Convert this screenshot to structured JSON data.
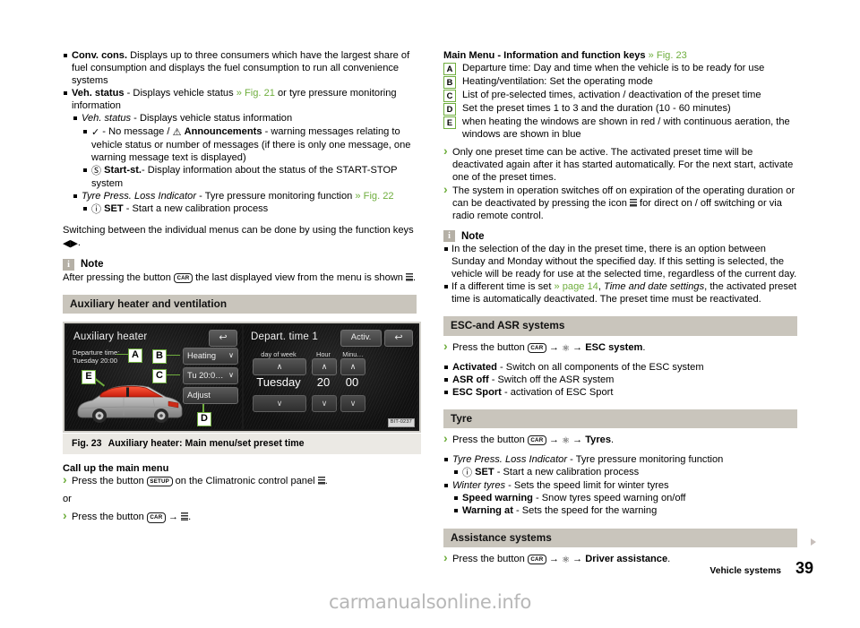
{
  "left_column": {
    "bullets": [
      {
        "level": 1,
        "term": "Conv. cons.",
        "text": " Displays up to three consumers which have the largest share of fuel consumption and displays the fuel consumption to run all convenience systems"
      },
      {
        "level": 1,
        "term": "Veh. status",
        "text": " - Displays vehicle status ",
        "ref": "» Fig. 21",
        "text_after": " or tyre pressure monitoring information"
      },
      {
        "level": 2,
        "term_italic": "Veh. status",
        "text": " - Displays vehicle status information"
      },
      {
        "level": 3,
        "prefix_glyph": "checkmark",
        "text_a": " - No message / ",
        "warn_glyph": "warning-triangle",
        "term": "Announcements",
        "text": " - warning messages relating to vehicle status or number of messages (if there is only one message, one warning message text is displayed)"
      },
      {
        "level": 3,
        "prefix_glyph": "start-stop",
        "term": "Start-st.",
        "text": "- Display information about the status of the START-STOP system"
      },
      {
        "level": 2,
        "term_italic": "Tyre Press. Loss Indicator",
        "text": " - Tyre pressure monitoring function ",
        "ref": "» Fig. 22"
      },
      {
        "level": 3,
        "prefix_glyph": "tyre-pressure",
        "term": "SET",
        "text": " - Start a new calibration process"
      }
    ],
    "switching_paragraph": "Switching between the individual menus can be done by using the function keys ",
    "switching_keys": "◀▶",
    "switching_end": ".",
    "note": {
      "title": "Note",
      "icon": "i",
      "text_before": "After pressing the button ",
      "key": "CAR",
      "text_after": " the last displayed view from the menu is shown ",
      "trailing_glyph": "climatronic",
      "period": "."
    },
    "section_heading": "Auxiliary heater and ventilation",
    "figure": {
      "screen_left": {
        "title": "Auxiliary heater",
        "back_icon": "back-arrow-icon",
        "departure_label_line1": "Departure time:",
        "departure_label_line2": "Tuesday 20:00",
        "buttons": [
          {
            "label": "Heating",
            "chevron": "∨"
          },
          {
            "label": "Tu  20:0…",
            "chevron": "∨"
          },
          {
            "label": "Adjust",
            "chevron": ""
          }
        ],
        "callouts": [
          "A",
          "B",
          "C",
          "D",
          "E"
        ]
      },
      "screen_right": {
        "title": "Depart. time 1",
        "activ_label": "Activ.",
        "back_icon": "back-arrow-icon",
        "col_headers": [
          "day of week",
          "Hour",
          "Minu…"
        ],
        "values": [
          "Tuesday",
          "20",
          "00"
        ],
        "up_chevron": "∧",
        "down_chevron": "∨",
        "code_tag": "BIT-0237"
      },
      "caption_number": "Fig. 23",
      "caption_text": "Auxiliary heater: Main menu/set preset time"
    },
    "call_up": {
      "heading": "Call up the main menu",
      "step1_before": "Press the button ",
      "step1_key": "SETUP",
      "step1_mid": " on the Climatronic control panel ",
      "step1_glyph": "climatronic",
      "step1_end": ".",
      "or": "or",
      "step2_before": "Press the button ",
      "step2_key": "CAR",
      "step2_arrow": "→",
      "step2_glyph": "climatronic",
      "step2_end": "."
    }
  },
  "right_column": {
    "main_menu_heading": "Main Menu - Information and function keys ",
    "main_menu_ref": "» Fig. 23",
    "key_legend": [
      {
        "key": "A",
        "text": "Departure time: Day and time when the vehicle is to be ready for use"
      },
      {
        "key": "B",
        "text": "Heating/ventilation: Set the operating mode"
      },
      {
        "key": "C",
        "text": "List of pre-selected times, activation / deactivation of the preset time"
      },
      {
        "key": "D",
        "text": "Set the preset times 1 to 3 and the duration (10 - 60 minutes)"
      },
      {
        "key": "E",
        "text": "when heating the windows are shown in red / with continuous aeration, the windows are shown in blue"
      }
    ],
    "arrow_notes": [
      "Only one preset time can be active. The activated preset time will be deactivated again after it has started automatically. For the next start, activate one of the preset times.",
      "The system in operation switches off on expiration of the operating duration or can be deactivated by pressing the icon ▒ for direct on / off switching or via radio remote control."
    ],
    "arrow_note2_part1": "The system in operation switches off on expiration of the operating duration or can be deactivated by pressing the icon ",
    "arrow_note2_part2": " for direct on / off switching or via radio remote control.",
    "note": {
      "title": "Note",
      "icon": "i",
      "bullets": [
        "In the selection of the day in the preset time, there is an option between Sunday and Monday without the specified day. If this setting is selected, the vehicle will be ready for use at the selected time, regardless of the current day.",
        "If a different time is set "
      ],
      "bullet2_ref": "» page 14",
      "bullet2_comma": ", ",
      "bullet2_italic": "Time and date settings",
      "bullet2_rest": ", the activated preset time is automatically deactivated. The preset time must be reactivated."
    },
    "sections": [
      {
        "heading": "ESC-and ASR systems",
        "press_before": "Press the button ",
        "press_key": "CAR",
        "press_arrow1": "→",
        "press_gear": "gear-icon",
        "press_arrow2": "→",
        "press_target": "ESC system",
        "press_end": ".",
        "bullets": [
          {
            "term": "Activated",
            "text": " - Switch on all components of the ESC system",
            "level": 1
          },
          {
            "term": "ASR off",
            "text": " - Switch off the ASR system",
            "level": 1
          },
          {
            "term": "ESC Sport",
            "text": " - activation of ESC Sport",
            "level": 1
          }
        ]
      },
      {
        "heading": "Tyre",
        "press_before": "Press the button ",
        "press_key": "CAR",
        "press_arrow1": "→",
        "press_gear": "gear-icon",
        "press_arrow2": "→",
        "press_target": "Tyres",
        "press_end": ".",
        "bullets": [
          {
            "term_italic": "Tyre Press. Loss Indicator",
            "text": " - Tyre pressure monitoring function",
            "level": 1
          },
          {
            "prefix_glyph": "tyre-pressure",
            "term": "SET",
            "text": " - Start a new calibration process",
            "level": 2
          },
          {
            "term_italic": "Winter tyres",
            "text": " - Sets the speed limit for winter tyres",
            "level": 1
          },
          {
            "term": "Speed warning",
            "text": " - Snow tyres speed warning on/off",
            "level": 2
          },
          {
            "term": "Warning at",
            "text": " - Sets the speed for the warning",
            "level": 2
          }
        ]
      },
      {
        "heading": "Assistance systems",
        "press_before": "Press the button ",
        "press_key": "CAR",
        "press_arrow1": "→",
        "press_gear": "gear-icon",
        "press_arrow2": "→",
        "press_target": "Driver assistance",
        "press_end": ".",
        "bullets": []
      }
    ]
  },
  "footer": {
    "label": "Vehicle systems",
    "page": "39"
  },
  "watermark": "carmanualsonline.info",
  "colors": {
    "reference_green": "#6fae3e",
    "section_header_bg": "#c9c5bc",
    "caption_bg": "#ebe9e4",
    "note_icon_bg": "#b5b0a6",
    "screen_bg": "#141414",
    "window_red": "#e03a26"
  }
}
